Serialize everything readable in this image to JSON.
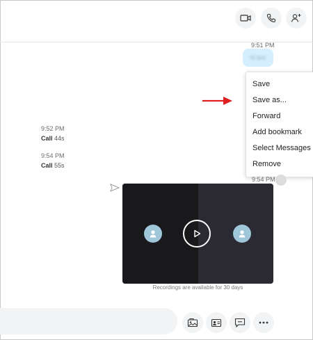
{
  "header": {
    "buttons": [
      {
        "icon": "video-call-icon"
      },
      {
        "icon": "phone-icon"
      },
      {
        "icon": "add-person-icon"
      }
    ]
  },
  "messages": {
    "sent_time": "9:51 PM",
    "sent_text_blurred": "hi bro",
    "calls": [
      {
        "time": "9:52 PM",
        "label": "Call",
        "duration": "44s"
      },
      {
        "time": "9:54 PM",
        "label": "Call",
        "duration": "55s"
      }
    ],
    "recording_time": "9:54 PM",
    "recording_note": "Recordings are available for 30 days"
  },
  "context_menu": {
    "items": [
      "Save",
      "Save as...",
      "Forward",
      "Add bookmark",
      "Select Messages",
      "Remove"
    ]
  },
  "annotation": {
    "arrow_color": "#e02020"
  },
  "colors": {
    "sent_bubble": "#d6efff",
    "accent": "#0078d4"
  },
  "composer": {
    "buttons": [
      {
        "icon": "media-gallery-icon"
      },
      {
        "icon": "contact-card-icon"
      },
      {
        "icon": "chat-bubble-icon"
      },
      {
        "icon": "more-options-icon"
      }
    ]
  }
}
